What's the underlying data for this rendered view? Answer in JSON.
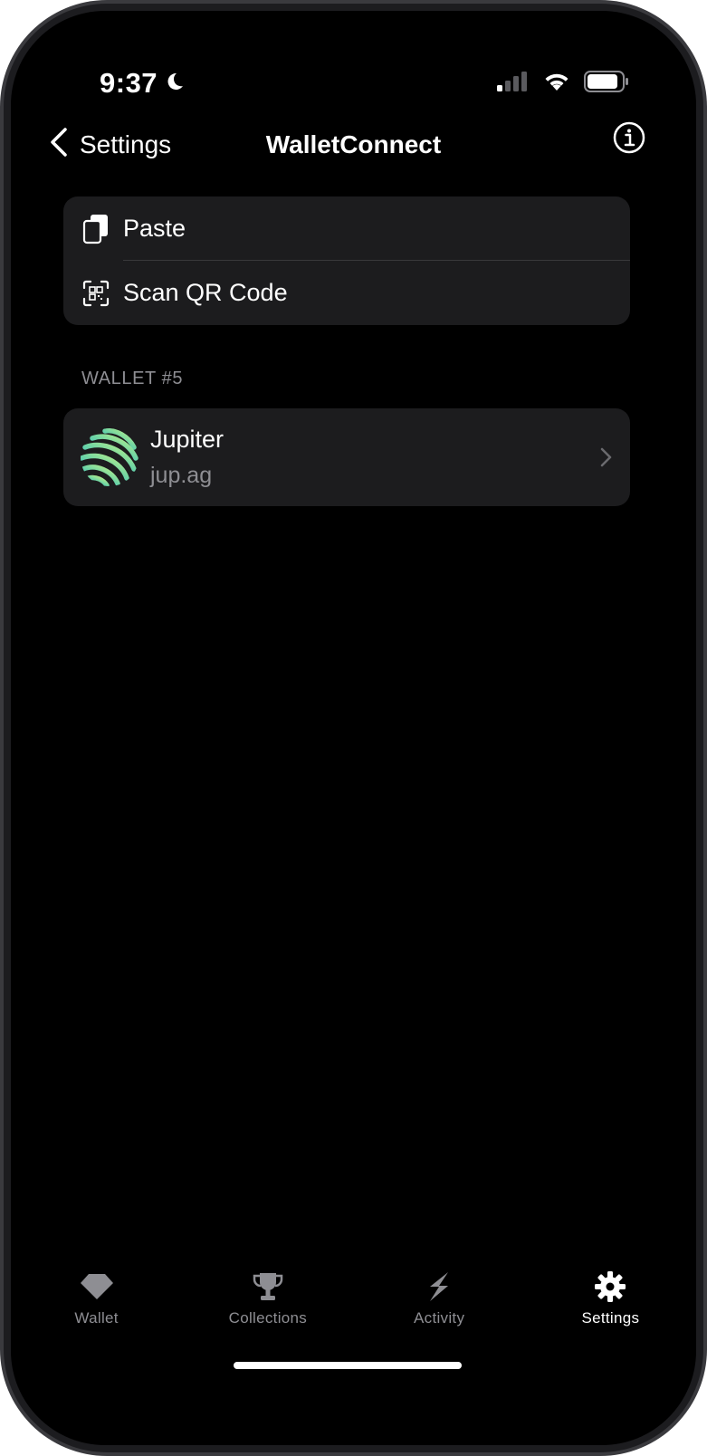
{
  "status_bar": {
    "time": "9:37",
    "focus_icon": "moon-icon",
    "signal_icon": "cellular-signal-icon",
    "wifi_icon": "wifi-icon",
    "battery_icon": "battery-icon"
  },
  "nav": {
    "back_label": "Settings",
    "title": "WalletConnect",
    "info_icon": "info-icon"
  },
  "actions": [
    {
      "label": "Paste",
      "icon": "clipboard-icon"
    },
    {
      "label": "Scan QR Code",
      "icon": "qr-scan-icon"
    }
  ],
  "section": {
    "header": "WALLET #5",
    "items": [
      {
        "name": "Jupiter",
        "url": "jup.ag",
        "icon": "jupiter-logo-icon"
      }
    ]
  },
  "tabbar": {
    "tabs": [
      {
        "label": "Wallet",
        "icon": "diamond-icon",
        "active": false
      },
      {
        "label": "Collections",
        "icon": "trophy-icon",
        "active": false
      },
      {
        "label": "Activity",
        "icon": "lightning-icon",
        "active": false
      },
      {
        "label": "Settings",
        "icon": "gear-icon",
        "active": true
      }
    ]
  },
  "colors": {
    "background": "#000000",
    "cell": "#1c1c1e",
    "secondary_text": "#8e8e93",
    "separator": "#38383a"
  }
}
